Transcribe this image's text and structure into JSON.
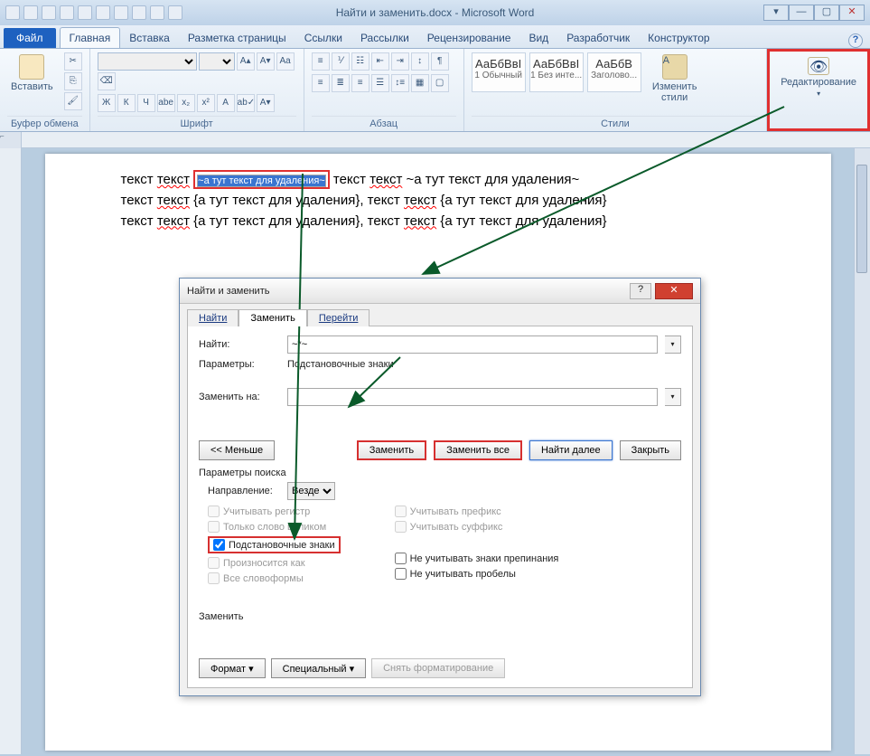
{
  "title": "Найти и заменить.docx - Microsoft Word",
  "qat_count": 10,
  "winbtns": {
    "restore": "▾",
    "min": "—",
    "max": "▢",
    "close": "✕"
  },
  "tabs": {
    "file": "Файл",
    "items": [
      "Главная",
      "Вставка",
      "Разметка страницы",
      "Ссылки",
      "Рассылки",
      "Рецензирование",
      "Вид",
      "Разработчик",
      "Конструктор"
    ],
    "active_index": 0
  },
  "ribbon": {
    "clipboard": {
      "paste": "Вставить",
      "label": "Буфер обмена"
    },
    "font": {
      "label": "Шрифт",
      "btns_row1": [
        "Ж",
        "К",
        "Ч",
        "abe",
        "x₂",
        "x²",
        "A",
        "ab✓",
        "A▾",
        "A▾"
      ]
    },
    "para": {
      "label": "Абзац"
    },
    "styles": {
      "label": "Стили",
      "items": [
        {
          "sample": "АаБбВвІ",
          "name": "1 Обычный"
        },
        {
          "sample": "АаБбВвІ",
          "name": "1 Без инте..."
        },
        {
          "sample": "АаБбВ",
          "name": "Заголово..."
        }
      ],
      "change": "Изменить стили"
    },
    "editing": {
      "label": "Редактирование",
      "icon": "👁"
    }
  },
  "document": {
    "line1_a": "текст ",
    "line1_wavy1": "текст",
    "line1_b": " ",
    "line1_hl": "~а тут текст для удаления~",
    "line1_c": " текст ",
    "line1_wavy2": "текст",
    "line1_d": " ~а тут текст для удаления~",
    "line2_a": "текст ",
    "line2_wavy1": "текст",
    "line2_b": " {а тут текст для удаления}, текст ",
    "line2_wavy2": "текст",
    "line2_c": " {а тут текст для удаления}",
    "line3_a": "текст ",
    "line3_wavy1": "текст",
    "line3_b": " {а тут текст для удаления}, текст ",
    "line3_wavy2": "текст",
    "line3_c": " {а тут текст для удаления}"
  },
  "dialog": {
    "title": "Найти и заменить",
    "tabs": [
      "Найти",
      "Заменить",
      "Перейти"
    ],
    "active_tab": 1,
    "find_label": "Найти:",
    "find_value": "~*~",
    "params_label": "Параметры:",
    "params_value": "Подстановочные знаки",
    "replace_label": "Заменить на:",
    "replace_value": "",
    "less": "<< Меньше",
    "btn_replace": "Заменить",
    "btn_replace_all": "Заменить все",
    "btn_find_next": "Найти далее",
    "btn_close": "Закрыть",
    "search_params": "Параметры поиска",
    "direction": "Направление:",
    "direction_val": "Везде",
    "chk_case": "Учитывать регистр",
    "chk_whole": "Только слово целиком",
    "chk_wildcards": "Подстановочные знаки",
    "chk_sounds": "Произносится как",
    "chk_forms": "Все словоформы",
    "chk_prefix": "Учитывать префикс",
    "chk_suffix": "Учитывать суффикс",
    "chk_punct": "Не учитывать знаки препинания",
    "chk_spaces": "Не учитывать пробелы",
    "replace_section": "Заменить",
    "btn_format": "Формат",
    "btn_special": "Специальный",
    "btn_noformat": "Снять форматирование"
  }
}
